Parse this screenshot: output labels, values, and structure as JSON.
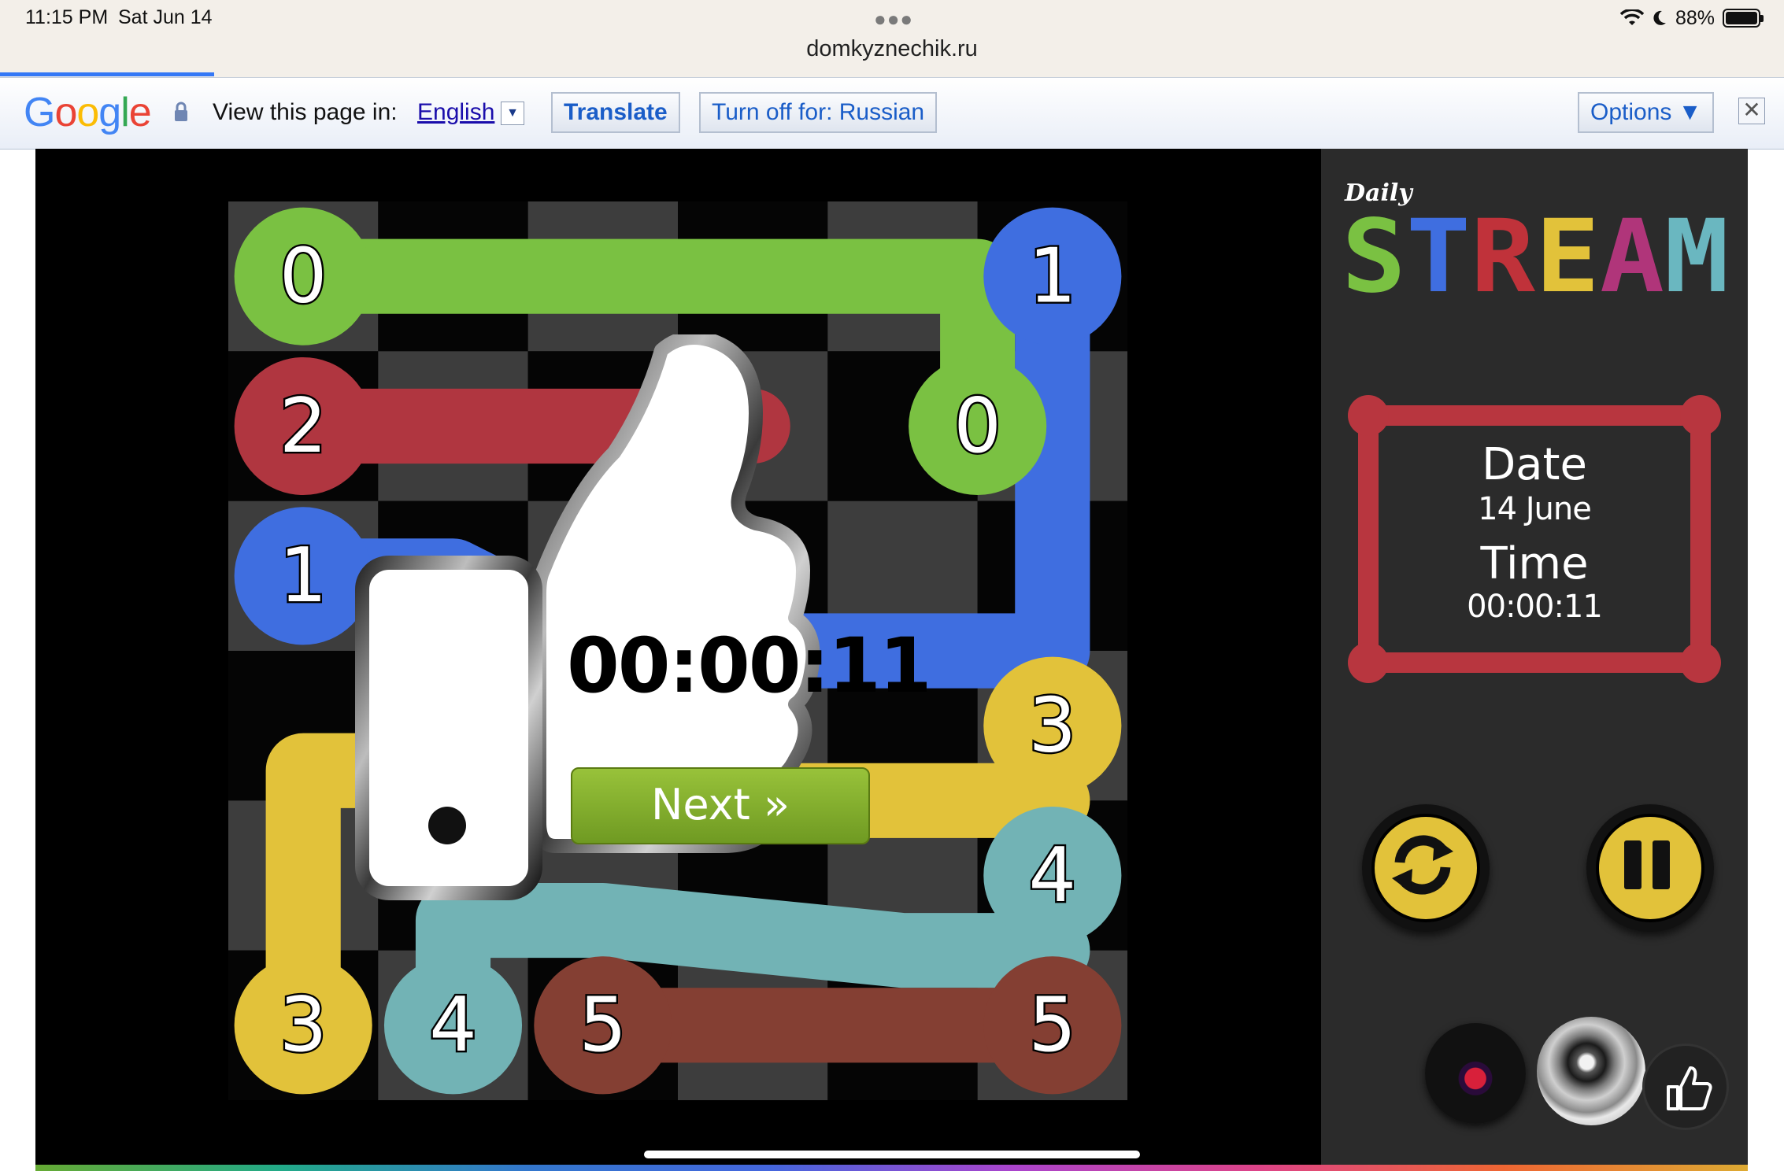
{
  "status_bar": {
    "time": "11:15 PM",
    "date": "Sat Jun 14",
    "battery": "88%",
    "url": "domkyznechik.ru"
  },
  "translate_bar": {
    "label": "View this page in:",
    "language": "English",
    "translate_button": "Translate",
    "turn_off_button": "Turn off for: Russian",
    "options_button": "Options ▼",
    "close_glyph": "✕"
  },
  "game": {
    "logo_small": "Daily",
    "logo_large": "STREAM",
    "logo_colors": [
      "#7ac142",
      "#3f6ee0",
      "#c0323a",
      "#e2c23a",
      "#b0357a",
      "#6ab7c0"
    ],
    "info": {
      "date_label": "Date",
      "date_value": "14 June",
      "time_label": "Time",
      "time_value": "00:00:11"
    },
    "overlay": {
      "time": "00:00:11",
      "next_button": "Next »"
    },
    "controls": {
      "restart": "restart-icon",
      "pause": "pause-icon",
      "record": "record-icon",
      "sound": "speaker-icon",
      "like": "thumbs-up-icon"
    },
    "board": {
      "rows": 6,
      "cols": 6,
      "flows": [
        {
          "label": "0",
          "color": "#7ac142",
          "path": [
            [
              0,
              0
            ],
            [
              0,
              1
            ],
            [
              0,
              2
            ],
            [
              0,
              3
            ],
            [
              0,
              4
            ],
            [
              1,
              4
            ]
          ]
        },
        {
          "label": "1",
          "color": "#3f6ee0",
          "path": [
            [
              0,
              5
            ],
            [
              1,
              5
            ],
            [
              2,
              5
            ],
            [
              2,
              4
            ],
            [
              2,
              3
            ],
            [
              2,
              2
            ],
            [
              2,
              1
            ],
            [
              2,
              0
            ]
          ]
        },
        {
          "label": "2",
          "color": "#b03640",
          "path": [
            [
              1,
              0
            ],
            [
              1,
              1
            ],
            [
              1,
              2
            ],
            [
              1,
              3
            ]
          ]
        },
        {
          "label": "3",
          "color": "#e2c23a",
          "path": [
            [
              6,
              0
            ],
            [
              3,
              0
            ],
            [
              3,
              1
            ],
            [
              3,
              2
            ],
            [
              3,
              3
            ],
            [
              3,
              4
            ],
            [
              3,
              5
            ]
          ]
        },
        {
          "label": "4",
          "color": "#72b3b5",
          "path": [
            [
              6,
              1
            ],
            [
              4,
              1
            ],
            [
              4,
              2
            ],
            [
              4,
              3
            ],
            [
              4,
              4
            ],
            [
              4,
              5
            ]
          ]
        },
        {
          "label": "5",
          "color": "#843f33",
          "path": [
            [
              6,
              2
            ],
            [
              6,
              3
            ],
            [
              6,
              4
            ],
            [
              6,
              5
            ]
          ]
        }
      ],
      "endpoints": [
        {
          "label": "0",
          "color": "#7ac142",
          "cell": [
            0,
            0
          ]
        },
        {
          "label": "0",
          "color": "#7ac142",
          "cell": [
            1,
            4.5
          ]
        },
        {
          "label": "1",
          "color": "#3f6ee0",
          "cell": [
            0,
            5
          ]
        },
        {
          "label": "1",
          "color": "#3f6ee0",
          "cell": [
            2,
            0
          ]
        },
        {
          "label": "2",
          "color": "#b03640",
          "cell": [
            1,
            0
          ]
        },
        {
          "label": "3",
          "color": "#e2c23a",
          "cell": [
            5,
            0
          ]
        },
        {
          "label": "3",
          "color": "#e2c23a",
          "cell": [
            3,
            5
          ]
        },
        {
          "label": "4",
          "color": "#72b3b5",
          "cell": [
            5,
            1
          ]
        },
        {
          "label": "4",
          "color": "#72b3b5",
          "cell": [
            4,
            5
          ]
        },
        {
          "label": "5",
          "color": "#843f33",
          "cell": [
            5,
            2
          ]
        },
        {
          "label": "5",
          "color": "#843f33",
          "cell": [
            5,
            5
          ]
        }
      ]
    }
  }
}
